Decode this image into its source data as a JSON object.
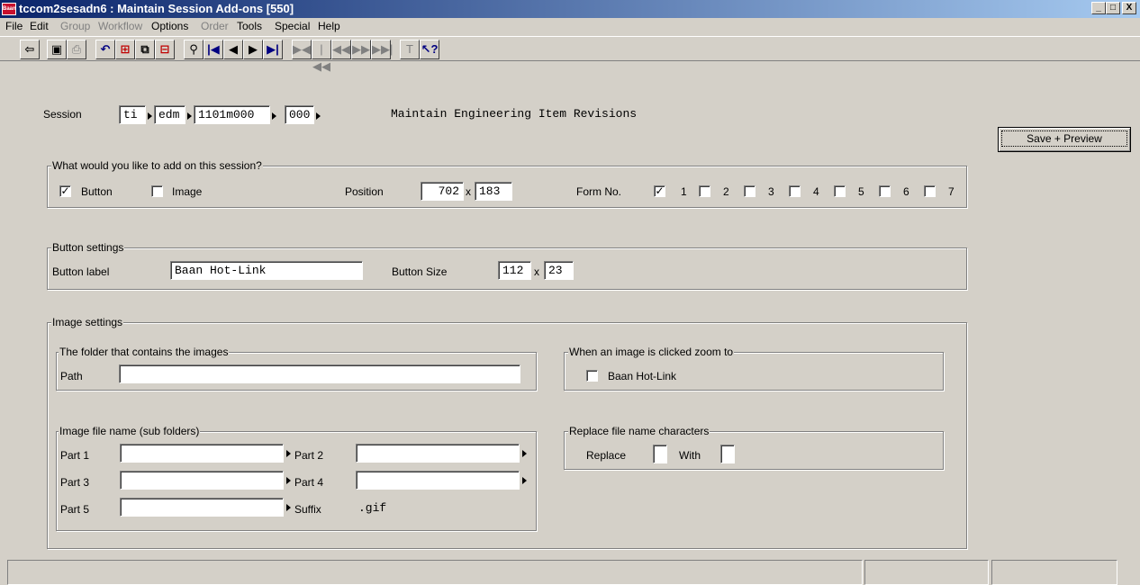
{
  "window": {
    "title": "tccom2sesadn6 : Maintain Session Add-ons [550]",
    "icon_text": "Baan",
    "minimize": "_",
    "maximize": "□",
    "close": "X"
  },
  "menu": [
    "File",
    "Edit",
    "Group",
    "Workflow",
    "Options",
    "Order",
    "Tools",
    "Special",
    "Help"
  ],
  "session": {
    "label": "Session",
    "package": "ti",
    "module": "edm",
    "code": "1101m000",
    "version": "000",
    "description": "Maintain Engineering Item Revisions"
  },
  "save_preview_label": "Save + Preview",
  "addon": {
    "group_title": "What would you like to add on this session?",
    "button_label": "Button",
    "button_checked": true,
    "image_label": "Image",
    "image_checked": false,
    "position_label": "Position",
    "position_x": "702",
    "position_y": "183",
    "times": "x",
    "form_label": "Form No.",
    "forms": [
      {
        "n": "1",
        "checked": true
      },
      {
        "n": "2",
        "checked": false
      },
      {
        "n": "3",
        "checked": false
      },
      {
        "n": "4",
        "checked": false
      },
      {
        "n": "5",
        "checked": false
      },
      {
        "n": "6",
        "checked": false
      },
      {
        "n": "7",
        "checked": false
      }
    ]
  },
  "button_settings": {
    "group_title": "Button settings",
    "label_caption": "Button label",
    "label_value": "Baan Hot-Link",
    "size_caption": "Button Size",
    "width": "112",
    "height": "23",
    "times": "x"
  },
  "image_settings": {
    "group_title": "Image settings",
    "folder_title": "The folder that contains the images",
    "path_label": "Path",
    "path_value": "",
    "zoom_title": "When an image is clicked zoom to",
    "zoom_option": "Baan Hot-Link",
    "zoom_checked": false,
    "filename_title": "Image file name (sub folders)",
    "part1": "Part 1",
    "part2": "Part 2",
    "part3": "Part 3",
    "part4": "Part 4",
    "part5": "Part 5",
    "suffix_label": "Suffix",
    "suffix_value": ".gif",
    "replace_title": "Replace file name characters",
    "replace_label": "Replace",
    "with_label": "With"
  }
}
